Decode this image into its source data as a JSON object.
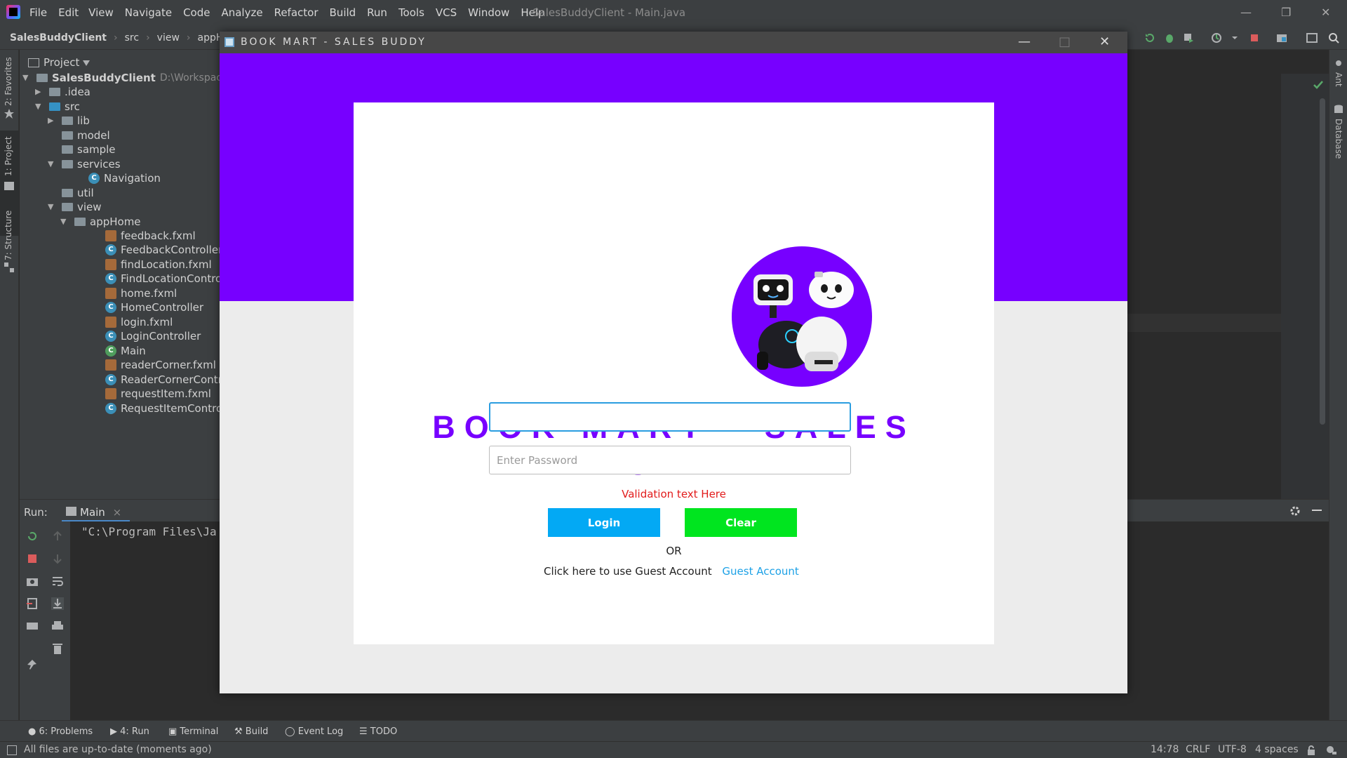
{
  "ide": {
    "menus": [
      "File",
      "Edit",
      "View",
      "Navigate",
      "Code",
      "Analyze",
      "Refactor",
      "Build",
      "Run",
      "Tools",
      "VCS",
      "Window",
      "Help"
    ],
    "window_title": "SalesBuddyClient - Main.java",
    "breadcrumbs": [
      "SalesBuddyClient",
      "src",
      "view",
      "appHome"
    ],
    "left_stripe": [
      "2: Favorites",
      "1: Project",
      "7: Structure"
    ],
    "right_stripe": [
      "Ant",
      "Database"
    ],
    "project_panel": {
      "title": "Project",
      "root": "SalesBuddyClient",
      "root_path": "D:\\Workspaces\\",
      "tree": [
        ".idea",
        "src",
        "lib",
        "model",
        "sample",
        "services",
        "Navigation",
        "util",
        "view",
        "appHome",
        "feedback.fxml",
        "FeedbackController",
        "findLocation.fxml",
        "FindLocationControlle",
        "home.fxml",
        "HomeController",
        "login.fxml",
        "LoginController",
        "Main",
        "readerCorner.fxml",
        "ReaderCornerControll",
        "requestItem.fxml",
        "RequestItemControlle"
      ]
    },
    "run_panel": {
      "label": "Run:",
      "tab": "Main",
      "console": "\"C:\\Program Files\\Ja"
    },
    "bottom_tabs": [
      "6: Problems",
      "4: Run",
      "Terminal",
      "Build",
      "Event Log",
      "TODO"
    ],
    "status": {
      "message": "All files are up-to-date (moments ago)",
      "position": "14:78",
      "line_sep": "CRLF",
      "encoding": "UTF-8",
      "indent": "4 spaces"
    }
  },
  "app": {
    "title": "BOOK MART - SALES BUDDY",
    "brand": "BOOK MART - SALES BUDDY",
    "username_value": "",
    "password_placeholder": "Enter Password",
    "validation_text": "Validation text Here",
    "login_label": "Login",
    "clear_label": "Clear",
    "or_text": "OR",
    "guest_prompt": "Click here to use Guest Account",
    "guest_link": "Guest Account",
    "colors": {
      "accent": "#7700ff",
      "login": "#03a9f4",
      "clear": "#00e51f",
      "error": "#e21b1b"
    }
  }
}
